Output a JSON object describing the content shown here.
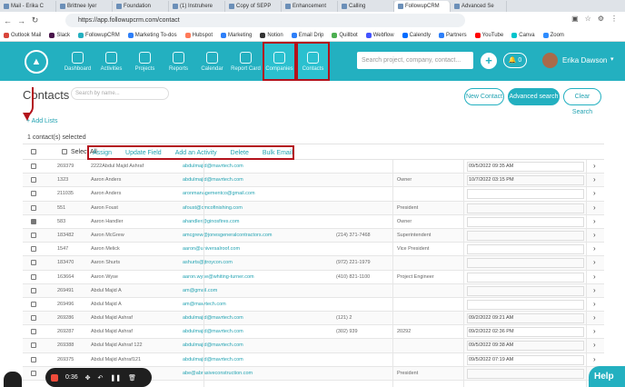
{
  "browser": {
    "tabs": [
      {
        "label": "Mail - Erika C",
        "active": false
      },
      {
        "label": "Brittnee Iyer",
        "active": false
      },
      {
        "label": "Foundation",
        "active": false
      },
      {
        "label": "(1) Instruhere",
        "active": false
      },
      {
        "label": "Copy of SEPP",
        "active": false
      },
      {
        "label": "Enhancement",
        "active": false
      },
      {
        "label": "Calling",
        "active": false
      },
      {
        "label": "FollowupCRM",
        "active": true
      },
      {
        "label": "Advanced Se",
        "active": false
      }
    ],
    "url": "https://app.followupcrm.com/contact",
    "bookmarks": [
      {
        "label": "Outlook Mail",
        "color": "#d8443a"
      },
      {
        "label": "Slack",
        "color": "#4a154b"
      },
      {
        "label": "FollowupCRM",
        "color": "#23b0c0"
      },
      {
        "label": "Marketing To-dos",
        "color": "#2d7ff9"
      },
      {
        "label": "Hubspot",
        "color": "#ff7a59"
      },
      {
        "label": "Marketing",
        "color": "#2d7ff9"
      },
      {
        "label": "Notion",
        "color": "#333333"
      },
      {
        "label": "Email Drip",
        "color": "#2d7ff9"
      },
      {
        "label": "Quillbot",
        "color": "#4caf50"
      },
      {
        "label": "Webflow",
        "color": "#4353ff"
      },
      {
        "label": "Calendly",
        "color": "#006bff"
      },
      {
        "label": "Partners",
        "color": "#2d7ff9"
      },
      {
        "label": "YouTube",
        "color": "#ff0000"
      },
      {
        "label": "Canva",
        "color": "#00c4cc"
      },
      {
        "label": "Zoom",
        "color": "#2d8cff"
      }
    ]
  },
  "nav": {
    "items": [
      {
        "label": "Dashboard",
        "icon": "dashboard-icon",
        "highlighted": false
      },
      {
        "label": "Activities",
        "icon": "activities-icon",
        "highlighted": false
      },
      {
        "label": "Projects",
        "icon": "projects-icon",
        "highlighted": false
      },
      {
        "label": "Reports",
        "icon": "reports-icon",
        "highlighted": false
      },
      {
        "label": "Calendar",
        "icon": "calendar-icon",
        "highlighted": false
      },
      {
        "label": "Report Card",
        "icon": "report-card-icon",
        "highlighted": false
      },
      {
        "label": "Companies",
        "icon": "companies-icon",
        "highlighted": true
      },
      {
        "label": "Contacts",
        "icon": "contacts-icon",
        "highlighted": true
      }
    ],
    "search_placeholder": "Search project, company, contact...",
    "notification_count": "0",
    "user_name": "Erika Dawson",
    "brand_color": "#23b0c0"
  },
  "page": {
    "title": "Contacts",
    "search_placeholder": "Search by name...",
    "buttons": {
      "new_contact": "New Contact",
      "advanced_search": "Advanced search",
      "clear_search": "Clear Search"
    },
    "add_lists": "Add Lists",
    "selected_text": "1 contact(s) selected",
    "select_all": "Select All",
    "actions": [
      "Assign",
      "Update Field",
      "Add an Activity",
      "Delete",
      "Bulk Email"
    ]
  },
  "rows": [
    {
      "id": "269379",
      "name": "2222Abdul Majid Ashraf",
      "email": "abdulmajid@mavrtech.com",
      "phone": "",
      "title": "",
      "date": "09/5/2022 09:35 AM",
      "checked": false
    },
    {
      "id": "1323",
      "name": "Aaron Anders",
      "email": "abdulmajid@mavrtech.com",
      "phone": "",
      "title": "Owner",
      "date": "10/7/2022 03:15 PM",
      "checked": false
    },
    {
      "id": "211035",
      "name": "Aaron Anders",
      "email": "aronmanagementco@gmail.com",
      "phone": "",
      "title": "",
      "date": "",
      "checked": false
    },
    {
      "id": "551",
      "name": "Aaron Foust",
      "email": "afoust@cmcofinishing.com",
      "phone": "",
      "title": "President",
      "date": "",
      "checked": false
    },
    {
      "id": "583",
      "name": "Aaron Handler",
      "email": "ahandler@ginosfires.com",
      "phone": "",
      "title": "Owner",
      "date": "",
      "checked": true
    },
    {
      "id": "183482",
      "name": "Aaron McGrew",
      "email": "amcgrew@jonesgeneralcontractors.com",
      "phone": "(214) 371-7468",
      "title": "Superintendent",
      "date": "",
      "checked": false
    },
    {
      "id": "1547",
      "name": "Aaron Melick",
      "email": "aaron@universalroof.com",
      "phone": "",
      "title": "Vice President",
      "date": "",
      "checked": false
    },
    {
      "id": "183470",
      "name": "Aaron Shurts",
      "email": "ashurts@jtroycon.com",
      "phone": "(972) 221-1979",
      "title": "",
      "date": "",
      "checked": false
    },
    {
      "id": "163664",
      "name": "Aaron Wyse",
      "email": "aaron.wyse@whiting-turner.com",
      "phone": "(410) 821-1100",
      "title": "Project Engineer",
      "date": "",
      "checked": false
    },
    {
      "id": "269491",
      "name": "Abdul Majid A",
      "email": "am@gmail.com",
      "phone": "",
      "title": "",
      "date": "",
      "checked": false
    },
    {
      "id": "269496",
      "name": "Abdul Majid A",
      "email": "am@mavrtech.com",
      "phone": "",
      "title": "",
      "date": "",
      "checked": false
    },
    {
      "id": "269286",
      "name": "Abdul Majid Ashraf",
      "email": "abdulmajid@mavrtech.com",
      "phone": "(121) 2",
      "title": "",
      "date": "09/2/2022 09:21 AM",
      "checked": false
    },
    {
      "id": "269287",
      "name": "Abdul Majid Ashraf",
      "email": "abdulmajid@mavrtech.com",
      "phone": "(302) 939",
      "title": "20292",
      "date": "09/2/2022 02:36 PM",
      "checked": false
    },
    {
      "id": "269388",
      "name": "Abdul Majid Ashraf 122",
      "email": "abdulmajid@mavrtech.com",
      "phone": "",
      "title": "",
      "date": "09/5/2022 09:38 AM",
      "checked": false
    },
    {
      "id": "269375",
      "name": "Abdul Majid Ashraf121",
      "email": "abdulmajid@mavrtech.com",
      "phone": "",
      "title": "",
      "date": "09/5/2022 07:19 AM",
      "checked": false
    },
    {
      "id": "",
      "name": "",
      "email": "abe@abrasiveconstruction.com",
      "phone": "",
      "title": "President",
      "date": "",
      "checked": false
    }
  ],
  "recorder": {
    "time": "0:36"
  },
  "help_label": "Help"
}
